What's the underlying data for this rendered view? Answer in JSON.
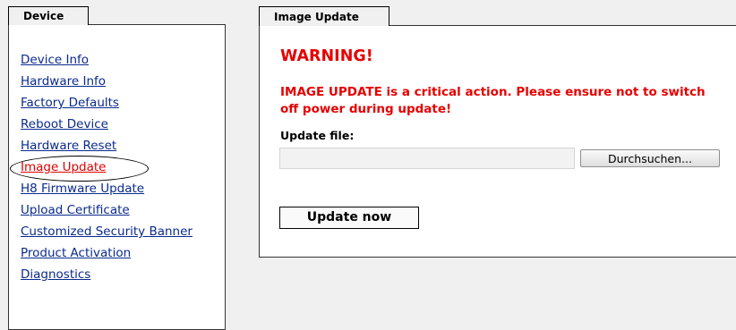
{
  "sidebar": {
    "tab_label": "Device",
    "items": [
      {
        "label": "Device Info"
      },
      {
        "label": "Hardware Info"
      },
      {
        "label": "Factory Defaults"
      },
      {
        "label": "Reboot Device"
      },
      {
        "label": "Hardware Reset"
      },
      {
        "label": "Image Update"
      },
      {
        "label": "H8 Firmware Update"
      },
      {
        "label": "Upload Certificate"
      },
      {
        "label": "Customized Security Banner"
      },
      {
        "label": "Product Activation"
      },
      {
        "label": "Diagnostics"
      }
    ],
    "active_item": "Image Update"
  },
  "main": {
    "tab_label": "Image Update",
    "warning_title": "WARNING!",
    "warning_text": "IMAGE UPDATE is a critical action. Please ensure not to switch off power during update!",
    "file_label": "Update file:",
    "file_value": "",
    "browse_label": "Durchsuchen...",
    "update_button_label": "Update now"
  },
  "colors": {
    "link": "#0a2a8c",
    "active_link": "#e00000",
    "warning": "#e60000"
  }
}
